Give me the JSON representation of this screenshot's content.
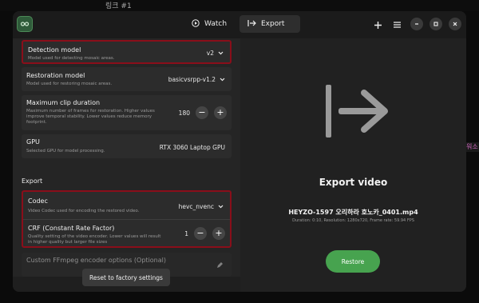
{
  "background": {
    "top_text": "링크 #1",
    "side_text": "워소"
  },
  "titlebar": {
    "tabs": [
      {
        "label": "Watch",
        "icon": "play-circle-icon"
      },
      {
        "label": "Export",
        "icon": "export-arrow-icon"
      }
    ],
    "actions": [
      "add-icon",
      "menu-icon",
      "minimize-icon",
      "maximize-icon",
      "close-icon"
    ]
  },
  "settings": {
    "detection": {
      "label": "Detection model",
      "desc": "Model used for detecting mosaic areas.",
      "value": "v2"
    },
    "restoration": {
      "label": "Restoration model",
      "desc": "Model used for restoring mosaic areas.",
      "value": "basicvsrpp-v1.2"
    },
    "clip": {
      "label": "Maximum clip duration",
      "desc": "Maximum number of frames for restoration. Higher values improve temporal stability. Lower values reduce memory footprint.",
      "value": "180"
    },
    "gpu": {
      "label": "GPU",
      "desc": "Selected GPU for model processing.",
      "value": "RTX 3060 Laptop GPU"
    },
    "export_section": "Export",
    "codec": {
      "label": "Codec",
      "desc": "Video Codec used for encoding the restored video.",
      "value": "hevc_nvenc"
    },
    "crf": {
      "label": "CRF (Constant Rate Factor)",
      "desc": "Quality setting of the video encoder. Lower values will result in higher quality but larger file sizes",
      "value": "1"
    },
    "ffmpeg": {
      "label": "Custom FFmpeg encoder options (Optional)"
    },
    "reset_label": "Reset to factory settings"
  },
  "export": {
    "title": "Export video",
    "file_name": "HEYZO-1597 오리하라 호노카_0401.mp4",
    "file_meta": "Duration: 0:10, Resolution: 1280x720, Frame rate: 59.94 FPS",
    "restore_label": "Restore"
  },
  "colors": {
    "accent_green": "#47a34f",
    "highlight_red": "#8a0e1a"
  }
}
